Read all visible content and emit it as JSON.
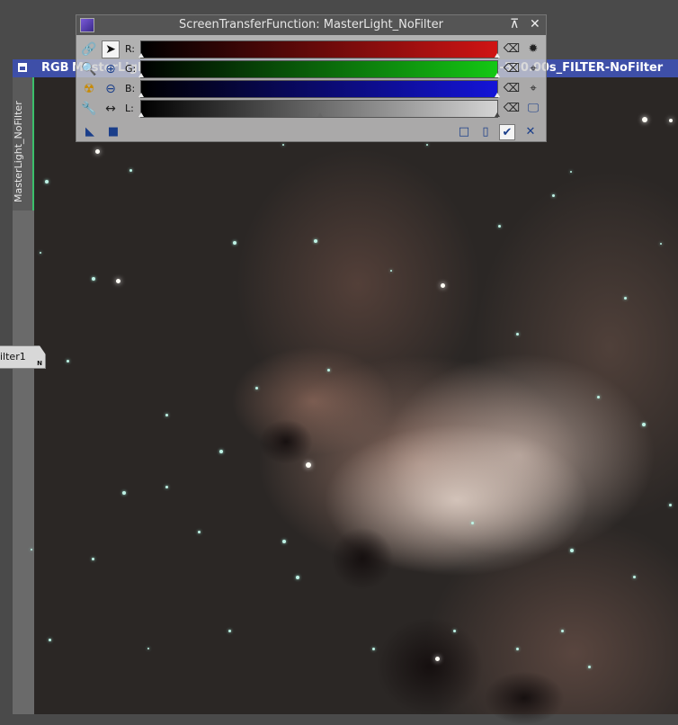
{
  "image_window": {
    "color_mode": "RGB",
    "title": "MasterLight_NoFilter | masterLight_BIN-2_2072x1410_EXPOSURE-300.00s_FILTER-NoFilter",
    "side_tab_label": "MasterLight_NoFilter",
    "floating_tab": {
      "label": "ilter1",
      "badge": "N"
    }
  },
  "stf_dialog": {
    "title": "ScreenTransferFunction: MasterLight_NoFilter",
    "channels": [
      {
        "label": "R:",
        "color": "#d01414"
      },
      {
        "label": "G:",
        "color": "#14c814"
      },
      {
        "label": "B:",
        "color": "#1414d8"
      },
      {
        "label": "L:",
        "color": "#d4d4d4"
      }
    ],
    "left_icons": [
      [
        "link-icon",
        "pointer-icon"
      ],
      [
        "zoom-icon",
        "zoom-in-icon"
      ],
      [
        "radiation-icon",
        "zoom-out-icon"
      ],
      [
        "wrench-icon",
        "horizontal-arrows-icon"
      ]
    ],
    "right_icons": [
      [
        "reset-icon",
        "gear-icon"
      ],
      [
        "reset-icon",
        "crosshair-icon"
      ],
      [
        "reset-icon",
        "crosshair-icon"
      ],
      [
        "reset-icon",
        "monitor-icon"
      ]
    ],
    "bottom_icons": {
      "left": [
        "new-instance-icon",
        "track-view-icon"
      ],
      "right": [
        "square-icon",
        "document-icon",
        "apply-icon",
        "reset-all-icon"
      ]
    }
  }
}
